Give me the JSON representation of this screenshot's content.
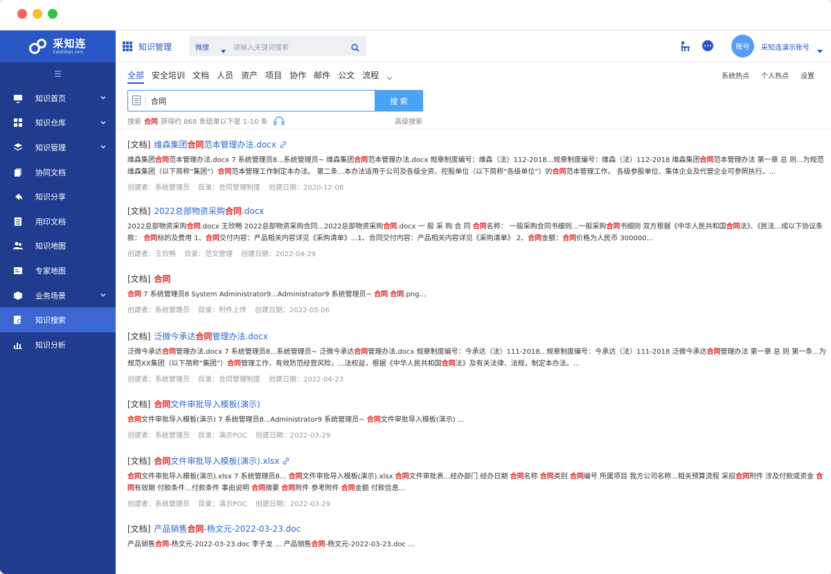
{
  "logo": {
    "name": "采知连",
    "sub": "Caizhilian.com"
  },
  "sidebar": {
    "collapse_symbol": "☰",
    "items": [
      {
        "label": "知识首页",
        "icon": "monitor-icon",
        "chevron": true
      },
      {
        "label": "知识仓库",
        "icon": "grid-icon",
        "chevron": true
      },
      {
        "label": "知识管理",
        "icon": "layers-icon",
        "chevron": true
      },
      {
        "label": "协同文档",
        "icon": "docs-icon",
        "chevron": false
      },
      {
        "label": "知识分享",
        "icon": "share-icon",
        "chevron": false
      },
      {
        "label": "用印文档",
        "icon": "list-icon",
        "chevron": false
      },
      {
        "label": "知识地图",
        "icon": "people-icon",
        "chevron": false
      },
      {
        "label": "专家地图",
        "icon": "card-icon",
        "chevron": false
      },
      {
        "label": "业务场景",
        "icon": "cube-icon",
        "chevron": true
      },
      {
        "label": "知识搜索",
        "icon": "search-doc-icon",
        "chevron": false,
        "active": true
      },
      {
        "label": "知识分析",
        "icon": "bar-chart-icon",
        "chevron": false
      }
    ]
  },
  "header": {
    "module_title": "知识管理",
    "search_type": "微搜",
    "search_placeholder": "请输入关键词搜索",
    "avatar_text": "账号",
    "account_name": "采知连演示账号"
  },
  "tabs": [
    "全部",
    "安全培训",
    "文档",
    "人员",
    "资产",
    "项目",
    "协作",
    "邮件",
    "公文",
    "流程"
  ],
  "right_links": [
    "系统热点",
    "个人热点",
    "设置"
  ],
  "query": {
    "value": "合同",
    "button": "搜 索"
  },
  "stats": {
    "prefix": "搜索",
    "keyword": "合同",
    "suffix": "获得约 868 条结果以下是 1-10 条",
    "advanced": "高级搜索"
  },
  "results": [
    {
      "tag": "[文档]",
      "title": [
        {
          "t": "维森集团"
        },
        {
          "t": "合同",
          "h": true
        },
        {
          "t": "范本管理办法.docx"
        }
      ],
      "has_link": true,
      "snippet": [
        {
          "t": "维森集团"
        },
        {
          "t": "合同",
          "h": true
        },
        {
          "t": "范本管理办法.docx 7 系统管理员8...系统管理员~ 维森集团"
        },
        {
          "t": "合同",
          "h": true
        },
        {
          "t": "范本管理办法.docx 规章制度编号：维森（法）112-2018...规章制度编号：维森（法）112-2018 维森集团"
        },
        {
          "t": "合同",
          "h": true
        },
        {
          "t": "范本管理办法 第一章 总 则...为规范维森集团（以下简称“集团”）"
        },
        {
          "t": "合同",
          "h": true
        },
        {
          "t": "范本管理工作制定本办法。 第二条...本办法适用于公司及各级全资、控股单位（以下简称“各级单位”）的"
        },
        {
          "t": "合同",
          "h": true
        },
        {
          "t": "范本管理工作。 各级参股单位、集体企业及代管企业可参照执行。..."
        }
      ],
      "meta": [
        "创建者：系统管理员",
        "目录：合同管理制度",
        "创建日期：2020-12-08"
      ]
    },
    {
      "tag": "[文档]",
      "title": [
        {
          "t": "2022总部物资采购"
        },
        {
          "t": "合同",
          "h": true
        },
        {
          "t": ".docx"
        }
      ],
      "has_link": false,
      "snippet": [
        {
          "t": "2022总部物资采购"
        },
        {
          "t": "合同",
          "h": true
        },
        {
          "t": ".docx 王欣畅 2022总部物资采购合同...2022总部物资采购"
        },
        {
          "t": "合同",
          "h": true
        },
        {
          "t": ".docx 一 般 采 购 合 同 "
        },
        {
          "t": "合同",
          "h": true
        },
        {
          "t": "名称： 一般采购合同书细则...一般采购"
        },
        {
          "t": "合同",
          "h": true
        },
        {
          "t": "书细则 双方根据《中华人民共和国"
        },
        {
          "t": "合同",
          "h": true
        },
        {
          "t": "法》、《民法...成以下协议条款： "
        },
        {
          "t": "合同",
          "h": true
        },
        {
          "t": "标的及费用 1、"
        },
        {
          "t": "合同",
          "h": true
        },
        {
          "t": "交付内容：产品相关内容详见《采购清单》...1、合同交付内容：产品相关内容详见《采购清单》 2、"
        },
        {
          "t": "合同",
          "h": true
        },
        {
          "t": "金额："
        },
        {
          "t": "合同",
          "h": true
        },
        {
          "t": "价格为人民币 300000..."
        }
      ],
      "meta": [
        "创建者：王欣畅",
        "目录：范文管理",
        "创建日期：2022-04-29"
      ]
    },
    {
      "tag": "[文档]",
      "title": [
        {
          "t": "合同",
          "h": true
        }
      ],
      "has_link": false,
      "snippet": [
        {
          "t": "合同",
          "h": true
        },
        {
          "t": " 7 系统管理员8 System Administrator9...Administrator9 系统管理员~ "
        },
        {
          "t": "合同",
          "h": true
        },
        {
          "t": " "
        },
        {
          "t": "合同",
          "h": true
        },
        {
          "t": ".png..."
        }
      ],
      "meta": [
        "创建者：系统管理员",
        "目录：附件上传",
        "创建日期：2022-05-06"
      ]
    },
    {
      "tag": "[文档]",
      "title": [
        {
          "t": "泛微今承达"
        },
        {
          "t": "合同",
          "h": true
        },
        {
          "t": "管理办法.docx"
        }
      ],
      "has_link": false,
      "snippet": [
        {
          "t": "泛微今承达"
        },
        {
          "t": "合同",
          "h": true
        },
        {
          "t": "管理办法.docx 7 系统管理员8...系统管理员~ 泛微今承达"
        },
        {
          "t": "合同",
          "h": true
        },
        {
          "t": "管理办法.docx 规章制度编号：今承达（法）111-2018...规章制度编号：今承达（法）111-2018 泛微今承达"
        },
        {
          "t": "合同",
          "h": true
        },
        {
          "t": "管理办法 第一章 总 则 第一条...为规范XX集团（以下简称“集团”）"
        },
        {
          "t": "合同",
          "h": true
        },
        {
          "t": "管理工作，有效防范经营风险，...法权益，根据《中华人民共和国"
        },
        {
          "t": "合同",
          "h": true
        },
        {
          "t": "法》及有关法律、法规，制定本办法。..."
        }
      ],
      "meta": [
        "创建者：系统管理员",
        "目录：合同管理制度",
        "创建日期：2022-04-23"
      ]
    },
    {
      "tag": "[文档]",
      "title": [
        {
          "t": "合同",
          "h": true
        },
        {
          "t": "文件审批导入模板(演示)"
        }
      ],
      "has_link": false,
      "snippet": [
        {
          "t": "合同",
          "h": true
        },
        {
          "t": "文件审批导入模板(演示) 7 系统管理员8...Administrator9 系统管理员~ "
        },
        {
          "t": "合同",
          "h": true
        },
        {
          "t": "文件审批导入模板(演示) ..."
        }
      ],
      "meta": [
        "创建者：系统管理员",
        "目录：演示POC",
        "创建日期：2022-03-29"
      ]
    },
    {
      "tag": "[文档]",
      "title": [
        {
          "t": "合同",
          "h": true
        },
        {
          "t": "文件审批导入模板(演示).xlsx"
        }
      ],
      "has_link": true,
      "snippet": [
        {
          "t": "合同",
          "h": true
        },
        {
          "t": "文件审批导入模板(演示).xlsx 7 系统管理员8... "
        },
        {
          "t": "合同",
          "h": true
        },
        {
          "t": "文件审批导入模板(演示).xlsx "
        },
        {
          "t": "合同",
          "h": true
        },
        {
          "t": "文件审批表...经办部门 经办日期 "
        },
        {
          "t": "合同",
          "h": true
        },
        {
          "t": "名称 "
        },
        {
          "t": "合同",
          "h": true
        },
        {
          "t": "类别 "
        },
        {
          "t": "合同",
          "h": true
        },
        {
          "t": "编号 所属项目 我方公司名称...相关预算流程 采招"
        },
        {
          "t": "合同",
          "h": true
        },
        {
          "t": "附件 涉及付款或资金 "
        },
        {
          "t": "合同",
          "h": true
        },
        {
          "t": "有效期 付款条件...付款条件 事由说明 "
        },
        {
          "t": "合同",
          "h": true
        },
        {
          "t": "摘要 "
        },
        {
          "t": "合同",
          "h": true
        },
        {
          "t": "附件 参考附件 "
        },
        {
          "t": "合同",
          "h": true
        },
        {
          "t": "金额 付款信息..."
        }
      ],
      "meta": [
        "创建者：系统管理员",
        "目录：演示POC",
        "创建日期：2022-03-29"
      ]
    },
    {
      "tag": "[文档]",
      "title": [
        {
          "t": "产品销售"
        },
        {
          "t": "合同",
          "h": true
        },
        {
          "t": "-杨文元-2022-03-23.doc"
        }
      ],
      "has_link": false,
      "snippet": [
        {
          "t": "产品销售"
        },
        {
          "t": "合同",
          "h": true
        },
        {
          "t": "-杨文元-2022-03-23.doc 李子龙 ... 产品销售"
        },
        {
          "t": "合同",
          "h": true
        },
        {
          "t": "-杨文元-2022-03-23.doc ..."
        }
      ],
      "meta": []
    }
  ]
}
